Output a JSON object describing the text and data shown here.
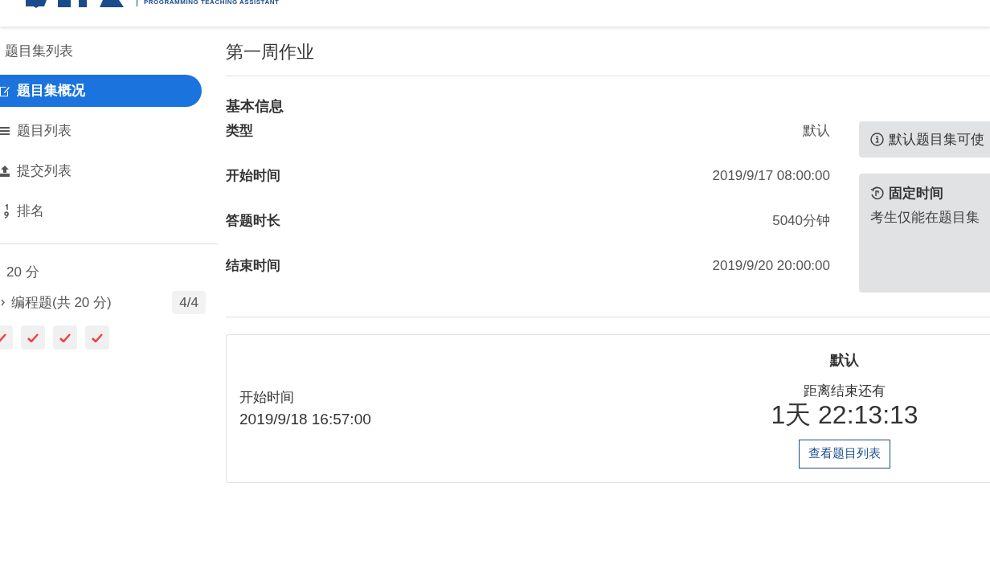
{
  "header": {
    "logo_tagline": "PROGRAMMING TEACHING ASSISTANT"
  },
  "sidebar": {
    "back_link": "题目集列表",
    "items": [
      {
        "label": "题目集概况",
        "kind": "edit",
        "selected": true
      },
      {
        "label": "题目列表",
        "kind": "list",
        "selected": false
      },
      {
        "label": "提交列表",
        "kind": "upload",
        "selected": false
      },
      {
        "label": "排名",
        "kind": "rank",
        "selected": false
      }
    ],
    "total": "20 分",
    "groups": [
      {
        "label": "编程题(共 20 分)",
        "count": "4/4",
        "expanded": false,
        "problems": [
          {
            "kind": "correct"
          },
          {
            "kind": "correct"
          },
          {
            "kind": "correct"
          },
          {
            "kind": "correct"
          }
        ]
      }
    ]
  },
  "main": {
    "title": "第一周作业",
    "section": "基本信息",
    "fields": [
      {
        "label": "类型",
        "value": "默认"
      },
      {
        "label": "开始时间",
        "value": "2019/9/17 08:00:00"
      },
      {
        "label": "答题时长",
        "value": "5040分钟"
      },
      {
        "label": "结束时间",
        "value": "2019/9/20 20:00:00"
      }
    ],
    "notes": [
      {
        "kind": "info",
        "text": "默认题目集可使"
      },
      {
        "kind": "fixed",
        "title": "固定时间",
        "text": "考生仅能在题目集"
      }
    ],
    "status": {
      "start_label": "开始时间",
      "start_value": "2019/9/18 16:57:00",
      "type": "默认",
      "remaining_label": "距离结束还有",
      "countdown": "1天 22:13:13",
      "button": "查看题目列表"
    }
  }
}
